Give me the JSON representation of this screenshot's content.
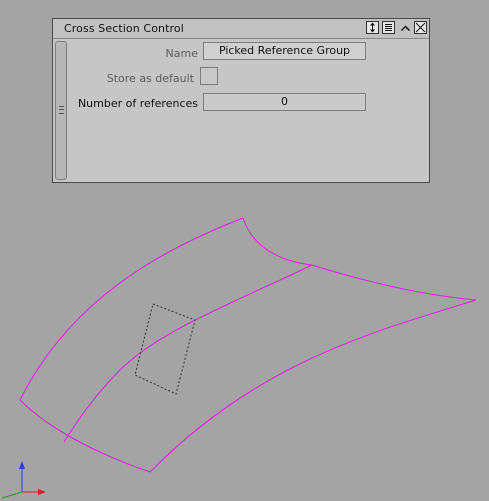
{
  "panel": {
    "title": "Cross Section Control",
    "buttons": [
      {
        "icon": "resize-arrows-icon"
      },
      {
        "icon": "list-menu-icon"
      },
      {
        "icon": "chevron-up-icon"
      },
      {
        "icon": "close-icon"
      }
    ]
  },
  "form": {
    "name_label": "Name",
    "name_value": "Picked Reference Group",
    "store_label": "Store as default",
    "store_checked": false,
    "refs_label": "Number of references",
    "refs_value": "0"
  },
  "viewport": {
    "curve_color": "#e01ee0",
    "section_color": "#333333",
    "axis_x_color": "#d42020",
    "axis_y_color": "#2a3fd8",
    "axis_origin_color": "#1a9a1a"
  }
}
